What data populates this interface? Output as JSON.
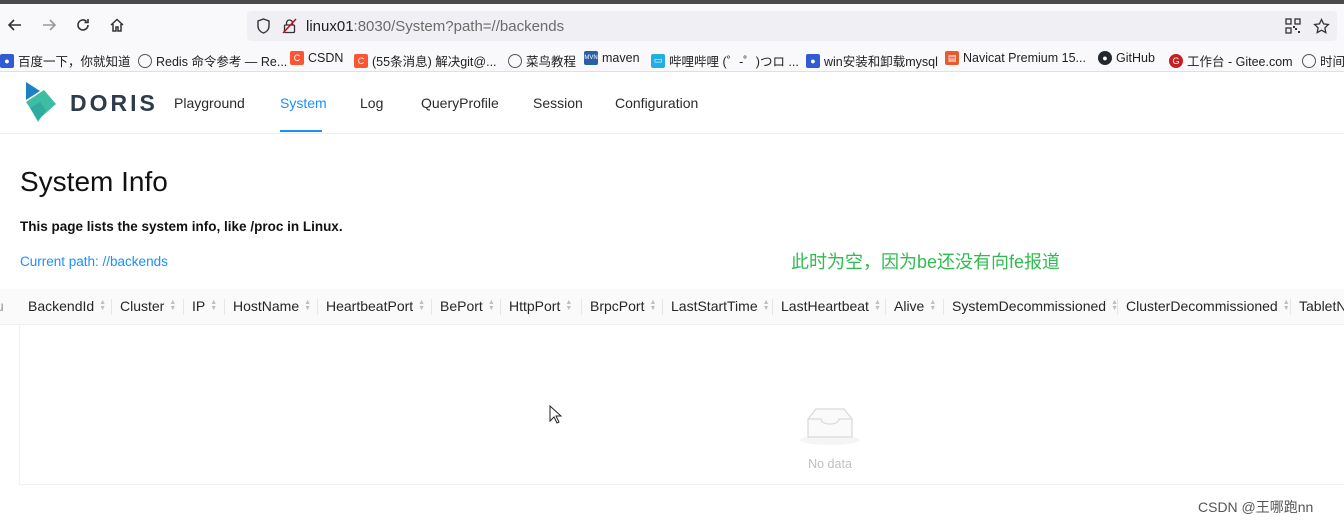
{
  "browser": {
    "url_host": "linux01",
    "url_rest": ":8030/System?path=//backends",
    "bookmarks": [
      "百度一下，你就知道",
      "Redis 命令参考 — Re...",
      "CSDN",
      "(55条消息) 解决git@...",
      "菜鸟教程",
      "maven",
      "哔哩哔哩 (゜-゜)つロ ...",
      "win安装和卸载mysql",
      "Navicat Premium 15...",
      "GitHub",
      "工作台 - Gitee.com",
      "时间"
    ]
  },
  "app": {
    "logo_text": "DORIS",
    "menu": [
      "Playground",
      "System",
      "Log",
      "QueryProfile",
      "Session",
      "Configuration"
    ],
    "active_menu": "System"
  },
  "page": {
    "title": "System Info",
    "description": "This page lists the system info, like /proc in Linux.",
    "current_path": "Current path: //backends"
  },
  "annotation": "此时为空，因为be还没有向fe报道",
  "table": {
    "columns": [
      "BackendId",
      "Cluster",
      "IP",
      "HostName",
      "HeartbeatPort",
      "BePort",
      "HttpPort",
      "BrpcPort",
      "LastStartTime",
      "LastHeartbeat",
      "Alive",
      "SystemDecommissioned",
      "ClusterDecommissioned",
      "TabletN"
    ],
    "empty_text": "No data"
  },
  "watermark": "CSDN @王哪跑nn",
  "colors": {
    "accent": "#1890ff",
    "annotation": "#2fbb4f"
  }
}
